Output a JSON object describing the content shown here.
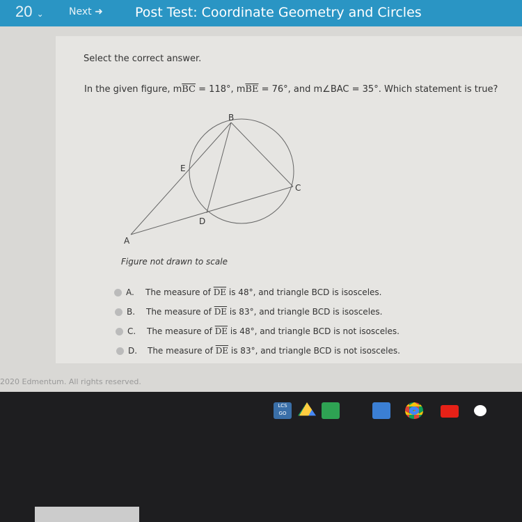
{
  "header": {
    "question_number": "20",
    "next_label": "Next",
    "title": "Post Test: Coordinate Geometry and Circles"
  },
  "question": {
    "instruction": "Select the correct answer.",
    "prompt_parts": [
      "In the given figure, m",
      "BC",
      " = 118°, m",
      "BE",
      " = 76°, and m∠BAC = 35°. Which statement is true?"
    ],
    "figure_labels": {
      "A": "A",
      "B": "B",
      "C": "C",
      "D": "D",
      "E": "E"
    },
    "figure_caption": "Figure not drawn to scale",
    "options": [
      {
        "letter": "A.",
        "pre": "The measure of",
        "arc": "DE",
        "post": "is 48°, and triangle BCD is isosceles."
      },
      {
        "letter": "B.",
        "pre": "The measure of",
        "arc": "DE",
        "post": "is 83°, and triangle BCD is isosceles."
      },
      {
        "letter": "C.",
        "pre": "The measure of",
        "arc": "DE",
        "post": "is 48°, and triangle BCD is not isosceles."
      },
      {
        "letter": "D.",
        "pre": "The measure of",
        "arc": "DE",
        "post": "is 83°, and triangle BCD is not isosceles."
      }
    ]
  },
  "footer": "2020 Edmentum. All rights reserved.",
  "taskbar": {
    "icons": [
      "learning-go-icon",
      "google-drive-icon",
      "google-classroom-icon",
      "play-arrow-icon",
      "chrome-icon",
      "youtube-icon",
      "google-play-icon"
    ],
    "lcs_label": "LCS GO"
  }
}
